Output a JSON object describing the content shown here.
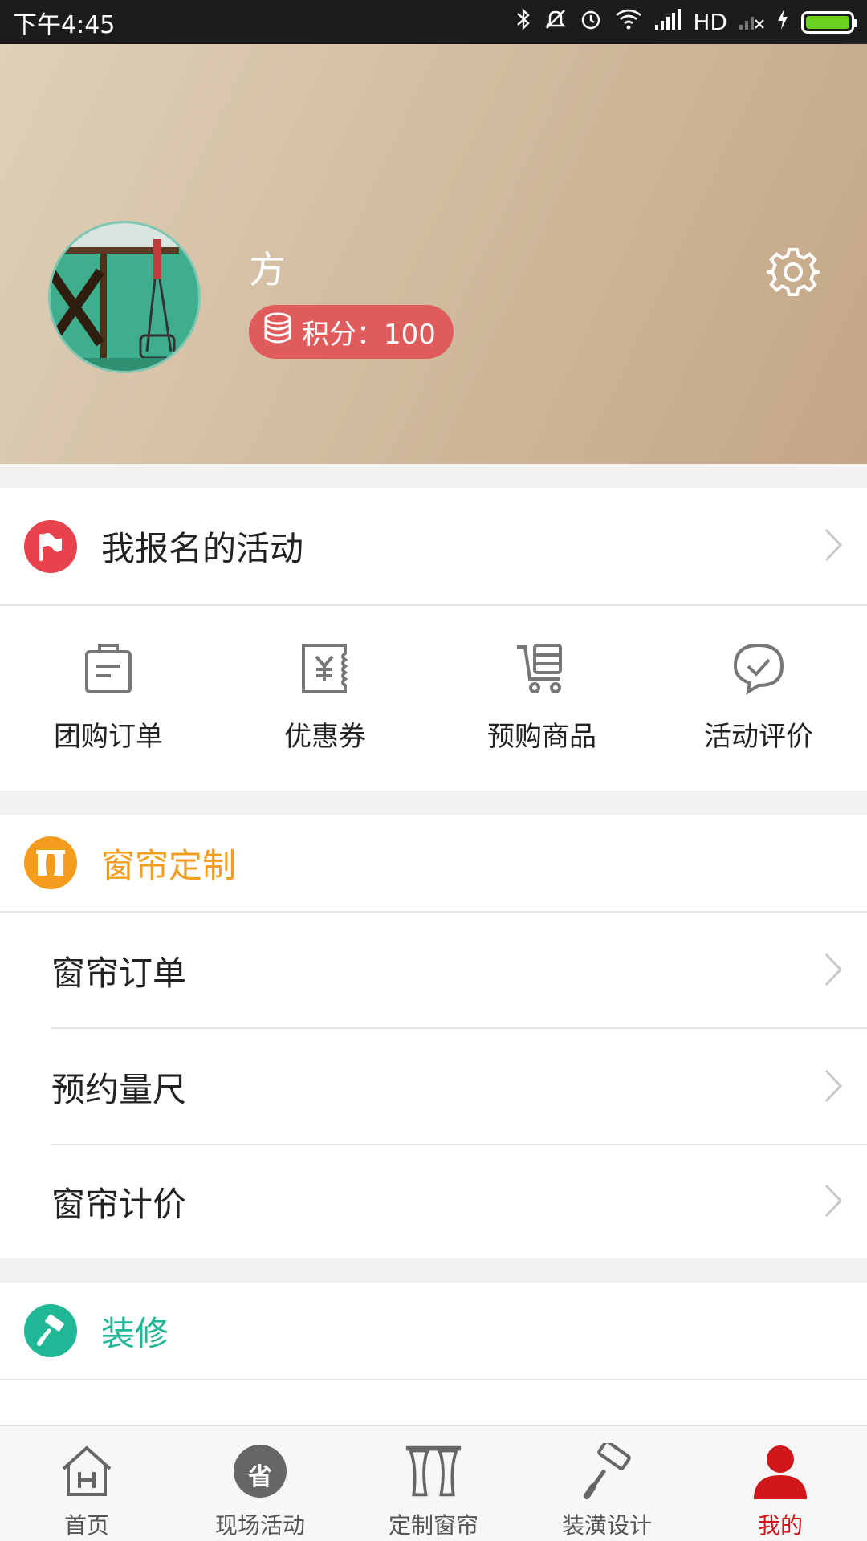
{
  "status_bar": {
    "time": "下午4:45",
    "network": "HD"
  },
  "profile": {
    "username": "方",
    "points_label": "积分",
    "points_value": "100",
    "points_text": "积分：100"
  },
  "activities": {
    "label": "我报名的活动"
  },
  "shortcuts": [
    {
      "label": "团购订单",
      "icon": "clipboard-icon"
    },
    {
      "label": "优惠券",
      "icon": "coupon-icon"
    },
    {
      "label": "预购商品",
      "icon": "cart-icon"
    },
    {
      "label": "活动评价",
      "icon": "comment-check-icon"
    }
  ],
  "curtain_section": {
    "title": "窗帘定制",
    "accent": "#f39c1d",
    "items": [
      {
        "label": "窗帘订单"
      },
      {
        "label": "预约量尺"
      },
      {
        "label": "窗帘计价"
      }
    ]
  },
  "decoration_section": {
    "title": "装修",
    "accent": "#1fb795"
  },
  "bottom_nav": [
    {
      "label": "首页",
      "icon": "home-icon"
    },
    {
      "label": "现场活动",
      "icon": "sheng-badge-icon",
      "badge_text": "省"
    },
    {
      "label": "定制窗帘",
      "icon": "curtain-icon"
    },
    {
      "label": "装潢设计",
      "icon": "paint-roller-icon"
    },
    {
      "label": "我的",
      "icon": "user-icon",
      "active": true
    }
  ],
  "colors": {
    "active": "#d0161b",
    "points_badge": "#e05c5c",
    "flag_red": "#e8424d"
  }
}
